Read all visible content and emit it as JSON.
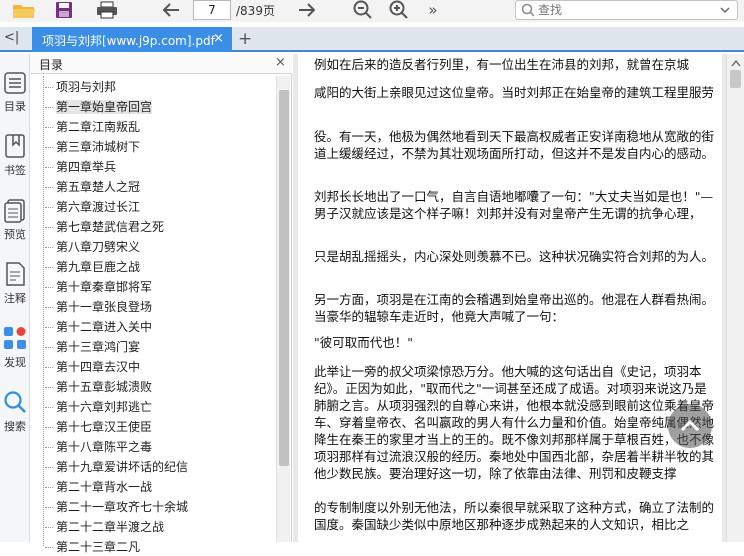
{
  "toolbar": {
    "page_current": "7",
    "page_total": "/839页",
    "search_placeholder": "查找",
    "more_symbol": "»"
  },
  "tab": {
    "title": "项羽与刘邦[www.j9p.com].pdf",
    "close_symbol": "×",
    "new_symbol": "+",
    "collapse_symbol": "<|"
  },
  "rail": {
    "items": [
      "目录",
      "书签",
      "预览",
      "注释",
      "发现",
      "搜索"
    ]
  },
  "outline": {
    "title": "目录",
    "close_symbol": "×",
    "items": [
      "项羽与刘邦",
      "第一章始皇帝回宫",
      "第二章江南叛乱",
      "第三章沛城树下",
      "第四章举兵",
      "第五章楚人之冠",
      "第六章渡过长江",
      "第七章楚武信君之死",
      "第八章刀劈宋义",
      "第九章巨鹿之战",
      "第十章秦章邯将军",
      "第十一章张良登场",
      "第十二章进入关中",
      "第十三章鸿门宴",
      "第十四章去汉中",
      "第十五章彭城溃败",
      "第十六章刘邦逃亡",
      "第十七章汉王使臣",
      "第十八章陈平之毒",
      "第十九章爱讲坏话的纪信",
      "第二十章背水一战",
      "第二十一章攻齐七十余城",
      "第二十二章半渡之战",
      "第二十三章二凡"
    ],
    "selected_index": 1
  },
  "document": {
    "paragraphs": [
      "例如在后来的造反者行列里，有一位出生在沛县的刘邦，就曾在京城",
      "咸阳的大街上亲眼见过这位皇帝。当时刘邦正在始皇帝的建筑工程里服劳",
      "役。有一天，他极为偶然地看到天下最高权威者正安详南稳地从宽敞的街道上缓缓经过，不禁为其壮观场面所打动，但这并不是发自内心的感动。",
      "刘邦长长地出了一口气，自言自语地嘟囔了一句：\"大丈夫当如是也！\"—男子汉就应该是这个样子嘛！刘邦并没有对皇帝产生无谓的抗争心理，",
      "只是胡乱摇摇头，内心深处则羡慕不已。这种状况确实符合刘邦的为人。",
      "另一方面，项羽是在江南的会稽遇到始皇帝出巡的。他混在人群看热闹。当豪华的辒辌车走近时，他竟大声喊了一句：",
      "\"彼可取而代也！\"",
      "此举让一旁的叔父项梁惊恐万分。他大喊的这句话出自《史记，项羽本纪》。正因为如此，\"取而代之\"一词甚至还成了成语。对项羽来说这乃是肺腑之言。从项羽强烈的自尊心来讲，他根本就没感到眼前这位乘着皇帝车、穿着皇帝衣、名叫嬴政的男人有什么力量和价值。始皇帝纯属偶然地降生在秦王的家里才当上的王的。既不像刘邦那样属于草根百姓，也不像项羽那样有过流浪汉般的经历。秦地处中国西北部，杂居着半耕半牧的其他少数民族。要治理好这一切，除了依靠由法律、刑罚和皮鞭支撑",
      "的专制制度以外别无他法，所以秦很早就采取了这种方式，确立了法制的国度。秦国缺少类似中原地区那种逐步成熟起来的人文知识，相比之"
    ]
  }
}
